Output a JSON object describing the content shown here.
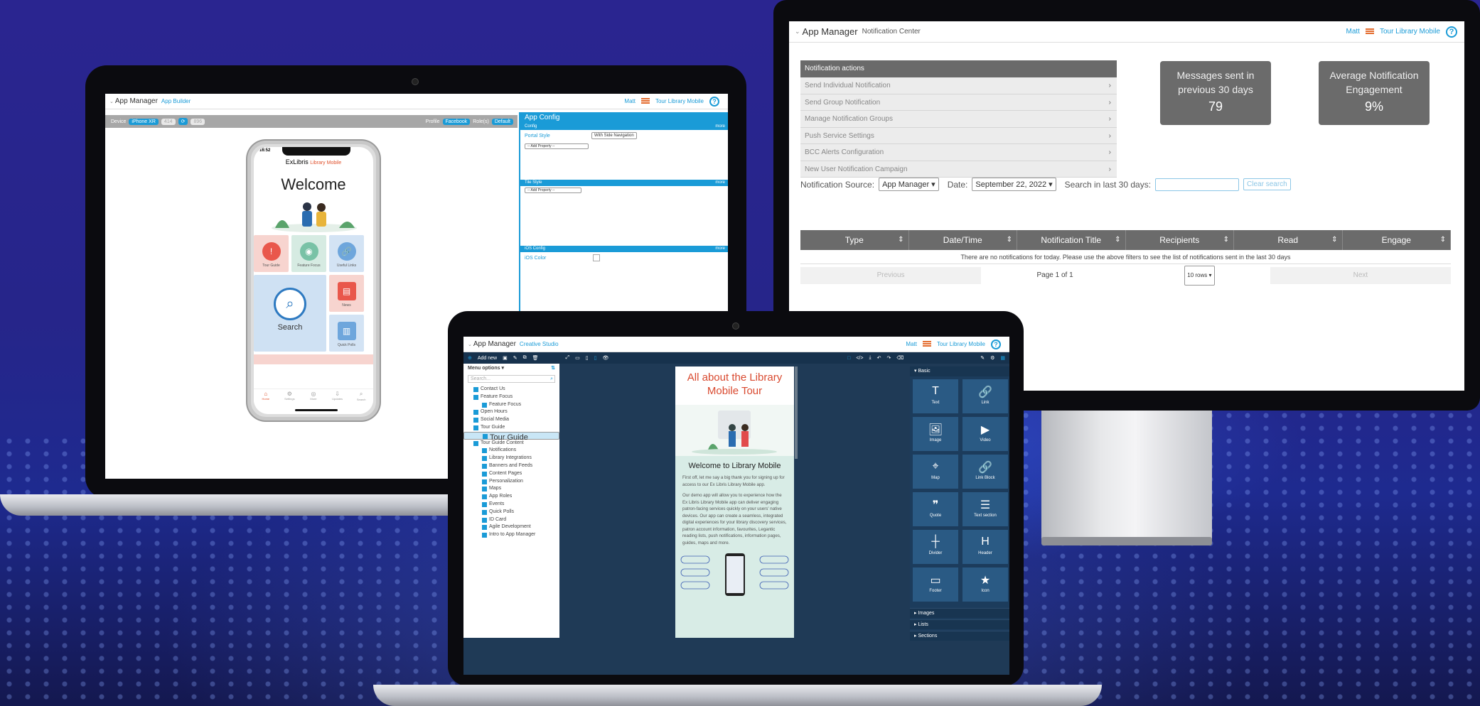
{
  "monitor": {
    "brand": "App Manager",
    "crumb": "Notification Center",
    "user": "Matt",
    "library": "Tour Library Mobile",
    "help": "?",
    "actions_header": "Notification actions",
    "actions": [
      "Send Individual Notification",
      "Send Group Notification",
      "Manage Notification Groups",
      "Push Service Settings",
      "BCC Alerts Configuration",
      "New User Notification Campaign"
    ],
    "stat1": {
      "title": "Messages sent in previous 30 days",
      "value": "79"
    },
    "stat2": {
      "title": "Average Notification Engagement",
      "value": "9%"
    },
    "filter": {
      "source_label": "Notification Source:",
      "source_value": "App Manager",
      "date_label": "Date:",
      "date_value": "September 22, 2022",
      "search_label": "Search in last 30 days:",
      "clear": "Clear search"
    },
    "columns": [
      "Type",
      "Date/Time",
      "Notification Title",
      "Recipients",
      "Read",
      "Engage"
    ],
    "empty": "There are no notifications for today. Please use the above filters to see the list of notifications sent in the last 30 days",
    "pager": {
      "prev": "Previous",
      "page": "Page 1 of 1",
      "rows": "10 rows",
      "next": "Next"
    }
  },
  "builder": {
    "brand": "App Manager",
    "crumb": "App Builder",
    "user": "Matt",
    "library": "Tour Library Mobile",
    "device_label": "Device",
    "device": "iPhone XR",
    "profile_label": "Profile",
    "profile": "Facebook",
    "role_label": "Role(s)",
    "role": "Default",
    "config_title": "App Config",
    "sec_config": "Config",
    "portal_style_label": "Portal Style",
    "portal_style": "With Side Navigation",
    "add_property": "-- Add Property --",
    "sec_tile": "Tile Style",
    "sec_ios": "iOS Config",
    "ios_color": "iOS Color",
    "more": "more",
    "phone": {
      "time": "16:52",
      "logo_a": "ExLibris",
      "logo_b": "Library Mobile",
      "welcome": "Welcome",
      "search": "Search",
      "tiles": [
        "Tour Guide",
        "Feature Focus",
        "Useful Links",
        "News",
        "Quick Polls"
      ],
      "nav": [
        "Home",
        "Settings",
        "More",
        "Updates",
        "Search"
      ]
    }
  },
  "studio": {
    "brand": "App Manager",
    "crumb": "Creative Studio",
    "user": "Matt",
    "library": "Tour Library Mobile",
    "add_new": "Add new",
    "menu_options": "Menu options",
    "search_placeholder": "Search...",
    "tree": [
      {
        "label": "Contact Us",
        "sub": false
      },
      {
        "label": "Feature Focus",
        "sub": false
      },
      {
        "label": "Feature Focus",
        "sub": true
      },
      {
        "label": "Open Hours",
        "sub": false
      },
      {
        "label": "Social Media",
        "sub": false
      },
      {
        "label": "Tour Guide",
        "sub": false
      },
      {
        "label": "Tour Guide",
        "sub": true,
        "sel": true
      },
      {
        "label": "Tour Guide Content",
        "sub": false
      },
      {
        "label": "Notifications",
        "sub": true
      },
      {
        "label": "Library Integrations",
        "sub": true
      },
      {
        "label": "Banners and Feeds",
        "sub": true
      },
      {
        "label": "Content Pages",
        "sub": true
      },
      {
        "label": "Personalization",
        "sub": true
      },
      {
        "label": "Maps",
        "sub": true
      },
      {
        "label": "App Roles",
        "sub": true
      },
      {
        "label": "Events",
        "sub": true
      },
      {
        "label": "Quick Polls",
        "sub": true
      },
      {
        "label": "ID Card",
        "sub": true
      },
      {
        "label": "Agile Development",
        "sub": true
      },
      {
        "label": "Intro to App Manager",
        "sub": true
      }
    ],
    "page_title": "All about the Library Mobile Tour",
    "page_heading": "Welcome to Library Mobile",
    "para1": "First off, let me say a big thank you for signing up for access to our Ex Libris Library Mobile app.",
    "para2": "Our demo app will allow you to experience how the Ex Libris Library Mobile app can deliver engaging patron-facing services quickly on your users' native devices. Our app can create a seamless, integrated digital experiences for your library discovery services, patron account information, favourites, Legantic reading lists, push notifications, information pages, guides, maps and more.",
    "basic": "Basic",
    "blocks": [
      {
        "label": "Text",
        "icon": "T"
      },
      {
        "label": "Link",
        "icon": "🔗"
      },
      {
        "label": "Image",
        "icon": "🖼"
      },
      {
        "label": "Video",
        "icon": "▶"
      },
      {
        "label": "Map",
        "icon": "⌖"
      },
      {
        "label": "Link Block",
        "icon": "🔗"
      },
      {
        "label": "Quote",
        "icon": "❞"
      },
      {
        "label": "Text section",
        "icon": "☰"
      },
      {
        "label": "Divider",
        "icon": "┼"
      },
      {
        "label": "Header",
        "icon": "H"
      },
      {
        "label": "Footer",
        "icon": "▭"
      },
      {
        "label": "Icon",
        "icon": "★"
      }
    ],
    "sections": [
      "Images",
      "Lists",
      "Sections"
    ]
  }
}
